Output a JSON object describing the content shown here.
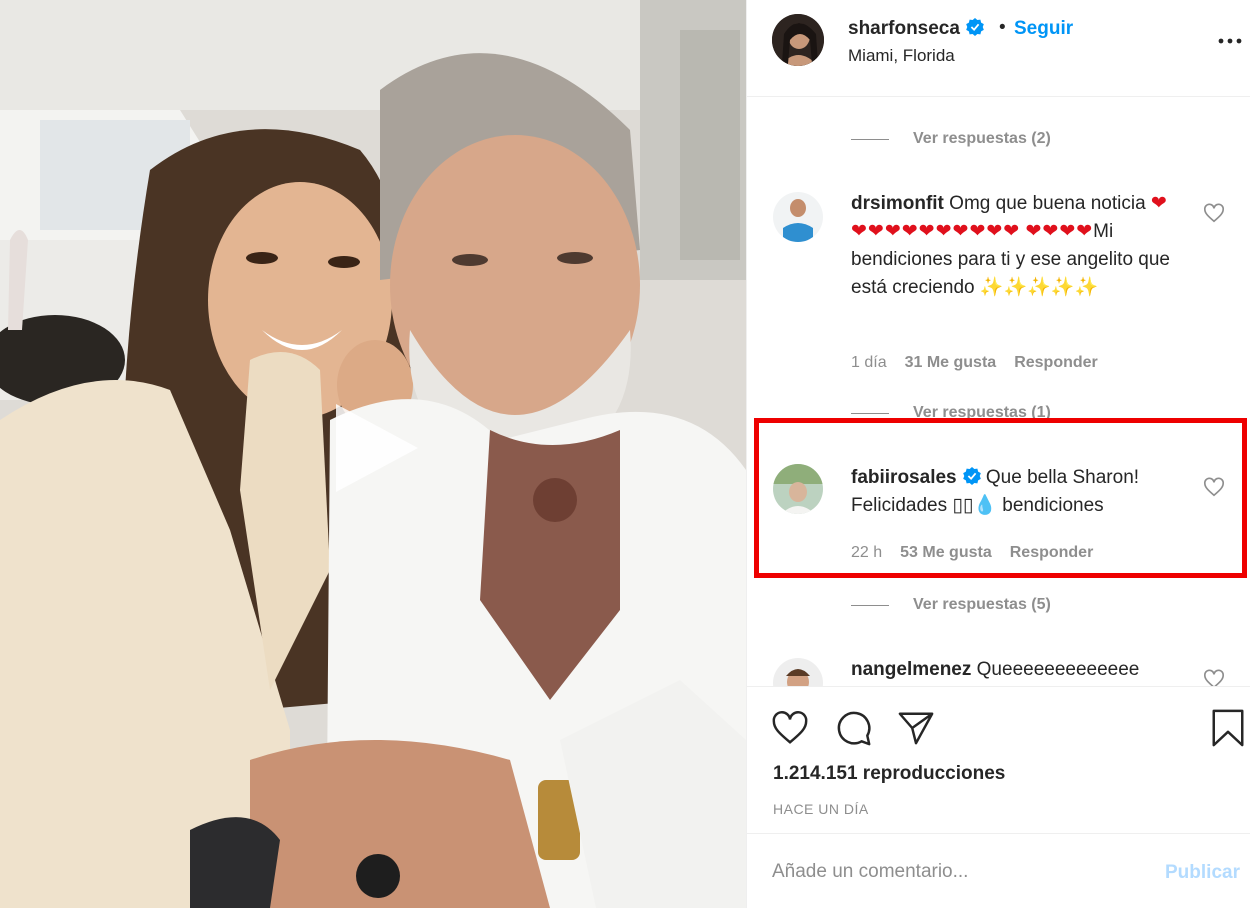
{
  "post": {
    "username": "sharfonseca",
    "follow_label": "Seguir",
    "separator": "•",
    "location": "Miami, Florida"
  },
  "comments": {
    "replies_top": "Ver respuestas (2)",
    "items": [
      {
        "username": "drsimonfit",
        "text_start": "Omg que buena noticia",
        "hearts_line1": "❤❤❤❤❤❤❤❤❤❤❤",
        "hearts_line2": "❤❤❤❤",
        "text_end": "Mi bendiciones para ti y ese angelito que está creciendo",
        "sparkles": "✨✨✨✨✨",
        "age": "1 día",
        "likes": "31 Me gusta",
        "reply": "Responder",
        "replies": "Ver respuestas (1)"
      },
      {
        "username": "fabiirosales",
        "text_start": "Que bella Sharon! Felicidades",
        "missing_glyphs": "▯▯",
        "emoji": "💧",
        "text_end": "bendiciones",
        "age": "22 h",
        "likes": "53 Me gusta",
        "reply": "Responder",
        "replies": "Ver respuestas (5)"
      },
      {
        "username": "nangelmenez",
        "text_start": "Queeeeeeeeeeeee"
      }
    ]
  },
  "footer": {
    "views": "1.214.151 reproducciones",
    "timestamp": "HACE UN DÍA",
    "comment_placeholder": "Añade un comentario...",
    "publish_label": "Publicar"
  },
  "colors": {
    "link_blue": "#0095f6",
    "highlight_red": "#ee0000",
    "muted_gray": "#8e8e8e",
    "publish_disabled": "#b3dbff"
  },
  "icons": [
    "verified-badge-icon",
    "more-options-icon",
    "heart-icon",
    "comment-icon",
    "share-icon",
    "bookmark-icon",
    "play-icon"
  ]
}
